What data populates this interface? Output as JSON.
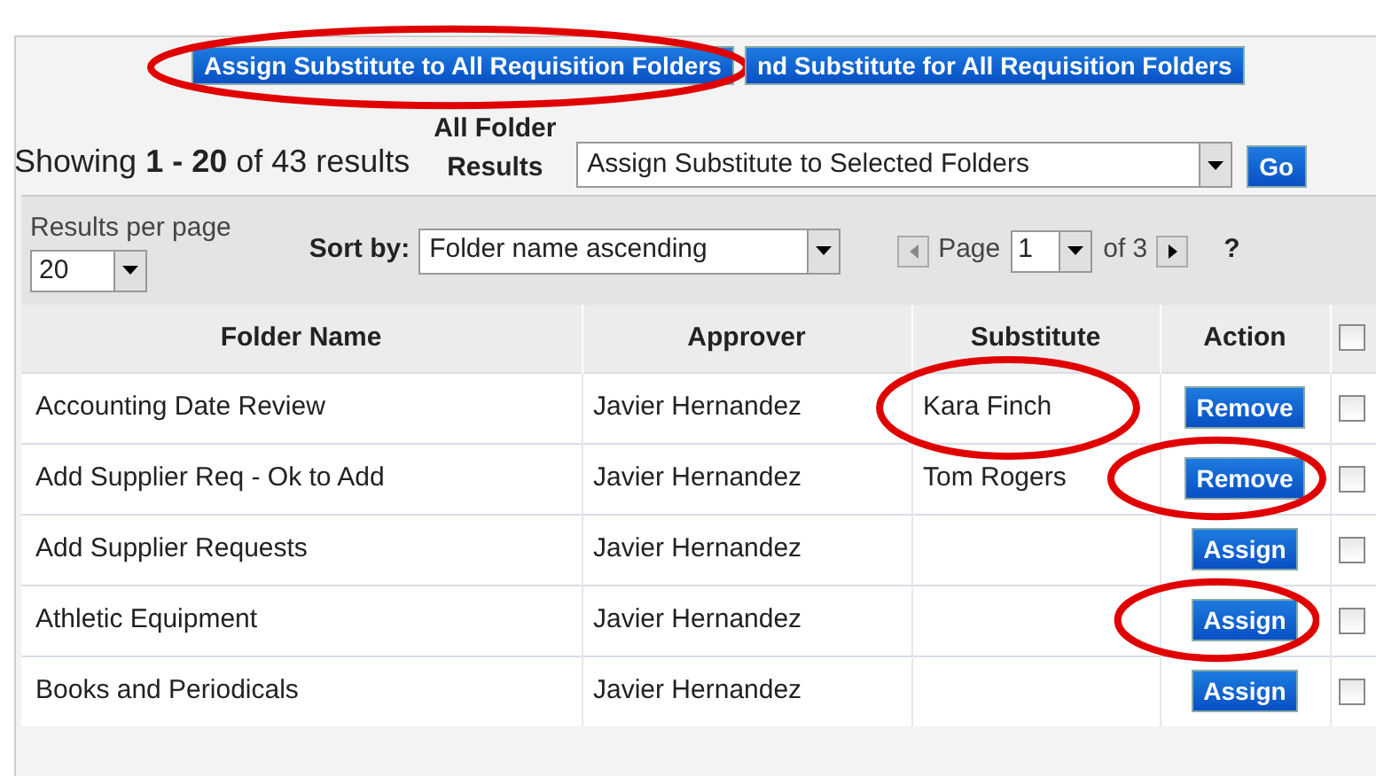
{
  "top_buttons": [
    {
      "label": "Assign Substitute to All Requisition Folders",
      "circled": true
    },
    {
      "label": "nd Substitute for All Requisition Folders",
      "circled": false
    }
  ],
  "summary": "Showing **1 - 20** of 43 results",
  "bulk": {
    "label": "All Folder Results",
    "value": "Assign Substitute to Selected Folders",
    "go": "Go"
  },
  "toolbar": {
    "per_page_label": "Results per page",
    "per_page": "20",
    "sort_label": "Sort by:",
    "sort": "Folder name ascending",
    "page_label": "Page",
    "page": "1",
    "of": "of 3",
    "help": "?"
  },
  "columns": [
    "Folder Name",
    "Approver",
    "Substitute",
    "Action"
  ],
  "select_all": {
    "checked": false
  },
  "rows": [
    {
      "folder": "Accounting Date Review",
      "approver": "Javier Hernandez",
      "substitute": "Kara Finch",
      "substitute_circled": true,
      "action": "Remove",
      "action_circled": false,
      "checked": false
    },
    {
      "folder": "Add Supplier Req - Ok to Add",
      "approver": "Javier Hernandez",
      "substitute": "Tom Rogers",
      "substitute_circled": false,
      "action": "Remove",
      "action_circled": true,
      "checked": false
    },
    {
      "folder": "Add Supplier Requests",
      "approver": "Javier Hernandez",
      "action": "Assign",
      "action_circled": false,
      "checked": false
    },
    {
      "folder": "Athletic Equipment",
      "approver": "Javier Hernandez",
      "action": "Assign",
      "action_circled": true,
      "checked": false
    },
    {
      "folder": "Books and Periodicals",
      "approver": "Javier Hernandez",
      "action": "Assign",
      "action_circled": false,
      "checked": false
    }
  ]
}
